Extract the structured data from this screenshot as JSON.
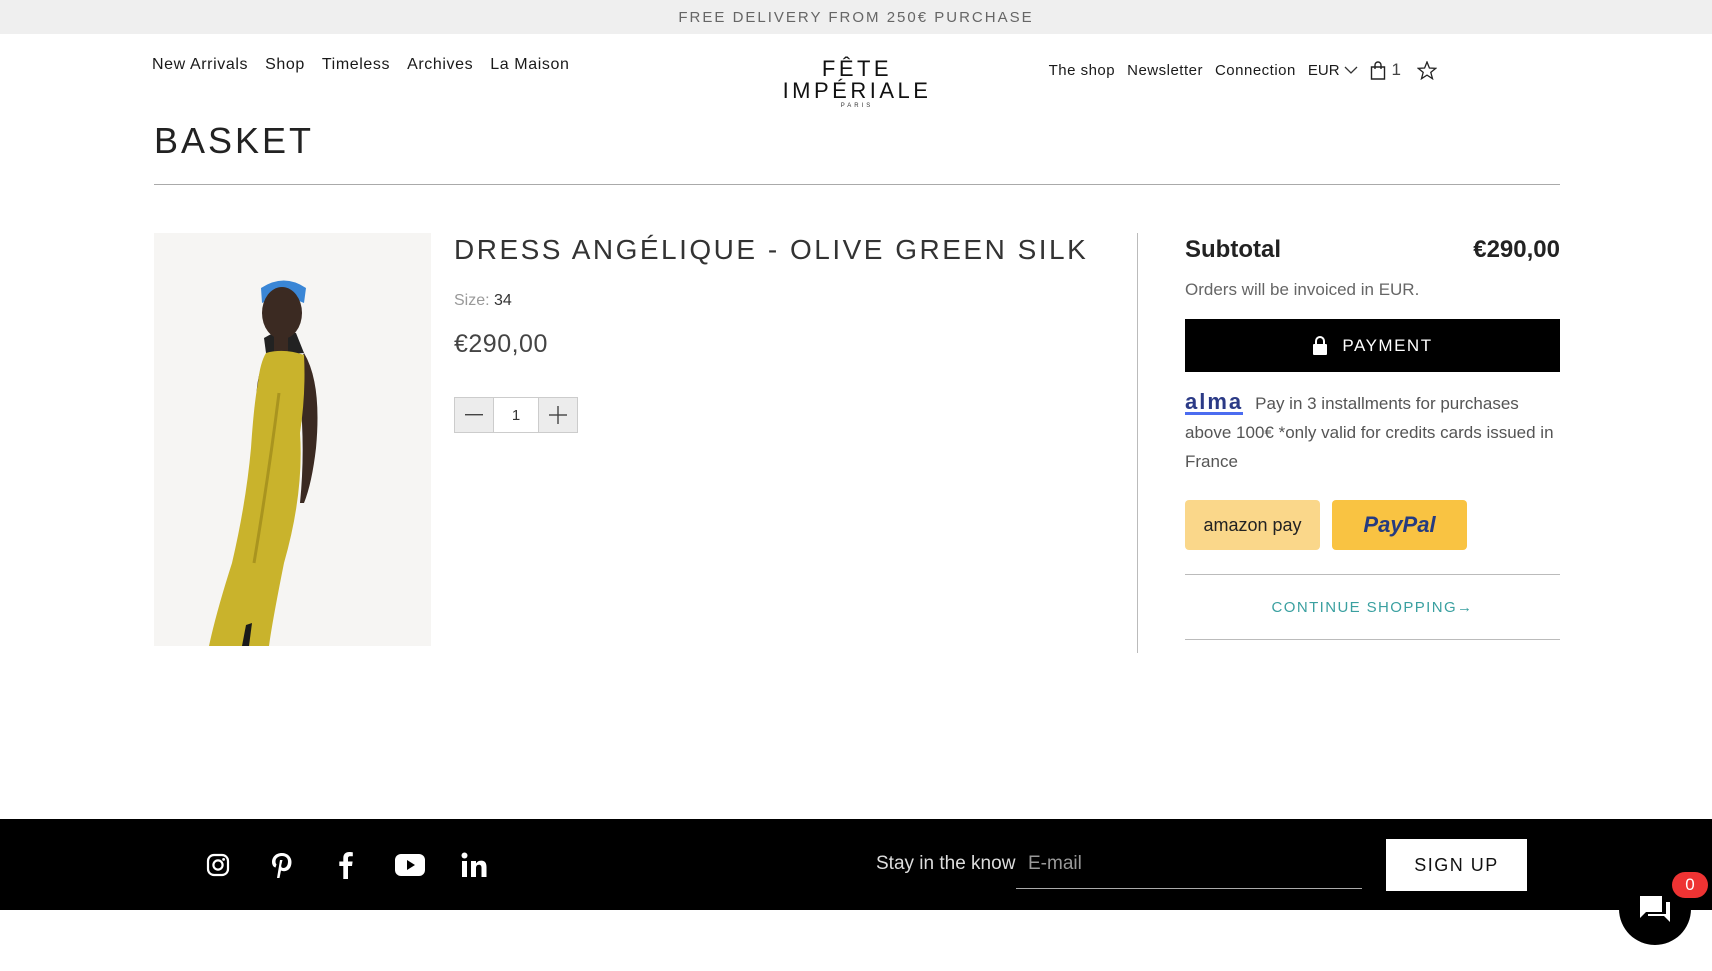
{
  "banner": {
    "text": "FREE DELIVERY FROM 250€ PURCHASE"
  },
  "header": {
    "nav_left": [
      "New Arrivals",
      "Shop",
      "Timeless",
      "Archives",
      "La Maison"
    ],
    "logo_main": "FÊTE IMPÉRIALE",
    "logo_sub": "PARIS",
    "nav_right": {
      "the_shop": "The shop",
      "newsletter": "Newsletter",
      "connection": "Connection",
      "currency": "EUR",
      "cart_count": "1"
    }
  },
  "page": {
    "title": "BASKET"
  },
  "item": {
    "name": "DRESS ANGÉLIQUE - OLIVE GREEN SILK",
    "size_label": "Size:",
    "size_value": "34",
    "price": "€290,00",
    "quantity": "1"
  },
  "summary": {
    "subtotal_label": "Subtotal",
    "subtotal_value": "€290,00",
    "invoice_note": "Orders will be invoiced in EUR.",
    "payment_label": "PAYMENT",
    "alma_logo": "alma",
    "alma_text": "Pay in 3 installments for purchases above 100€ *only valid for credits cards issued in France",
    "amazon_label": "amazon pay",
    "paypal_label": "PayPal",
    "continue_label": "CONTINUE SHOPPING→"
  },
  "footer": {
    "socials": [
      "instagram-icon",
      "pinterest-icon",
      "facebook-icon",
      "youtube-icon",
      "linkedin-icon"
    ],
    "stay_label": "Stay in the know",
    "email_placeholder": "E-mail",
    "signup_label": "SIGN UP"
  },
  "chat": {
    "badge": "0"
  },
  "colors": {
    "accent_teal": "#3aa0a0",
    "dress_yellow": "#c9b32c",
    "paypal_yellow": "#f9c342",
    "amazon_yellow": "#fad78a"
  }
}
